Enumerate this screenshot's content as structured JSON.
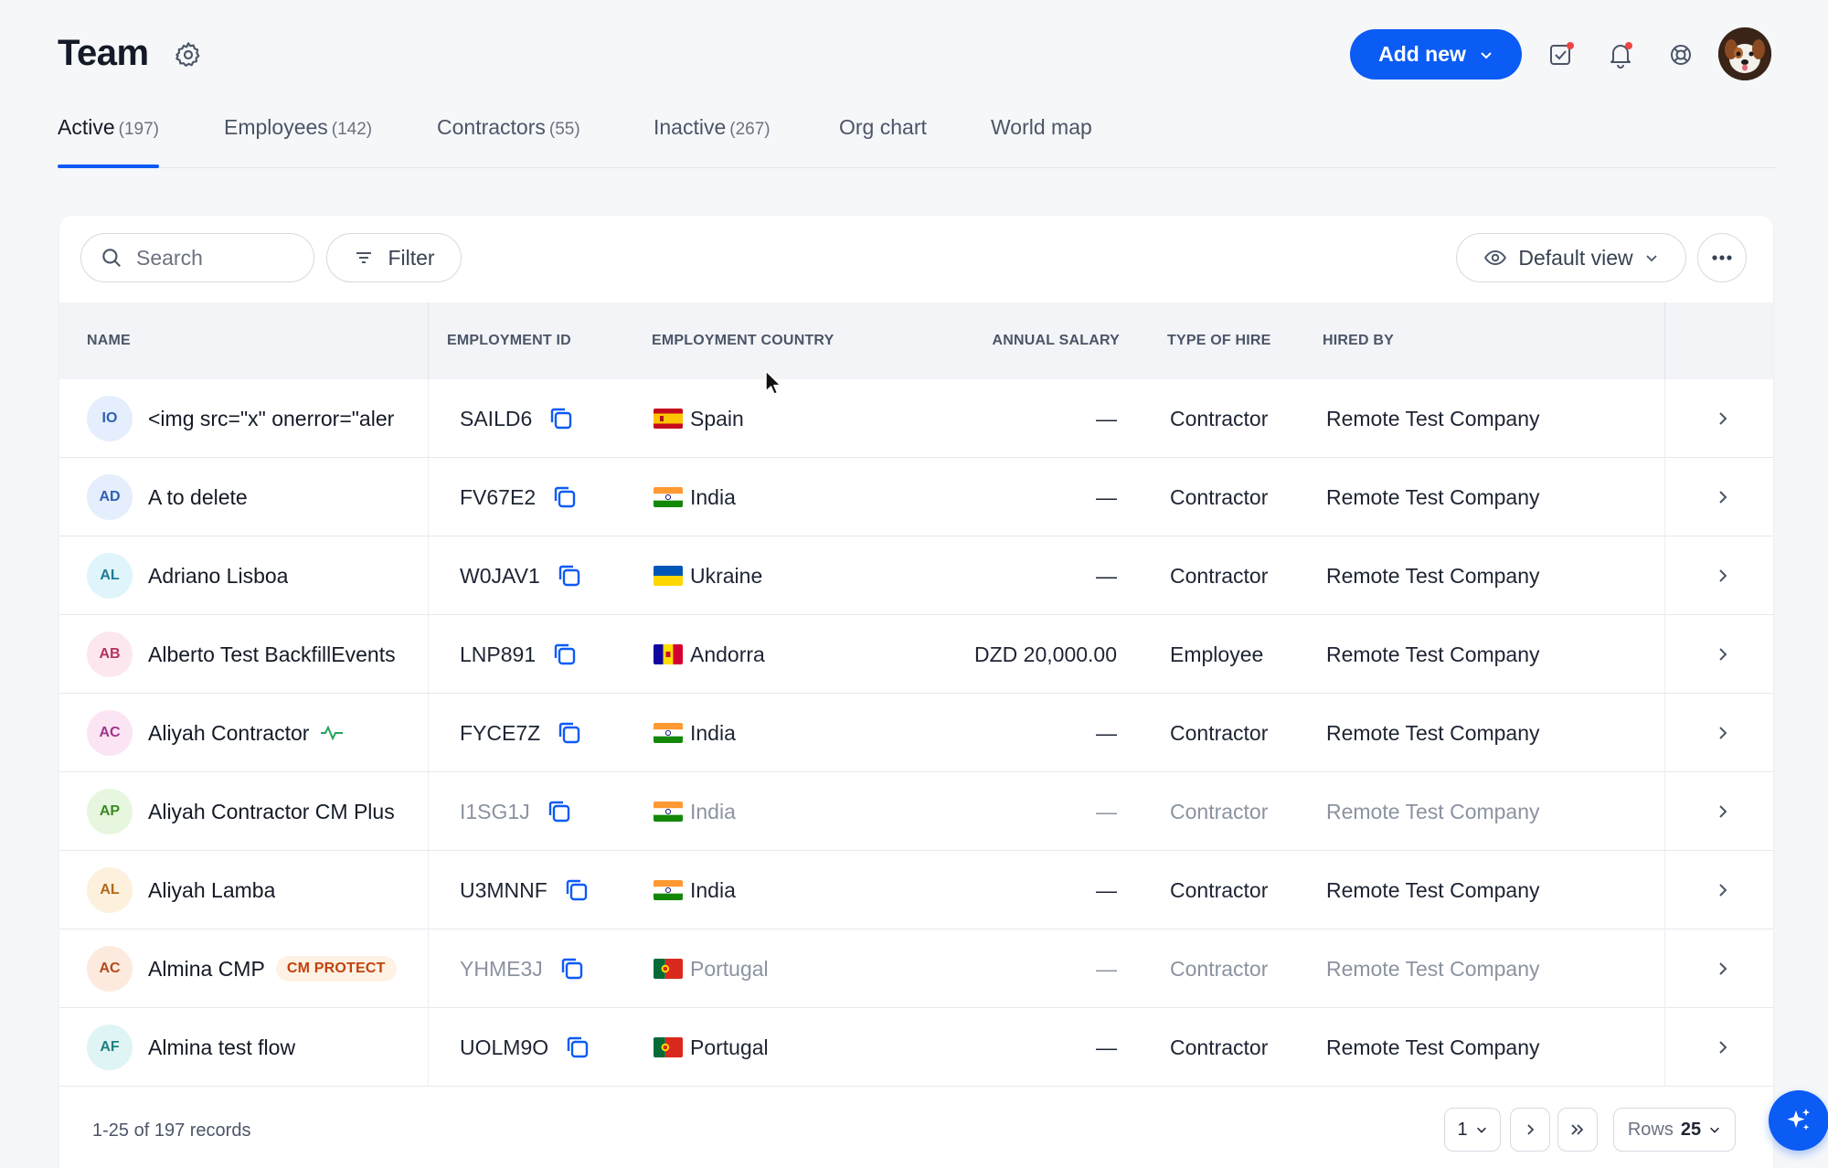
{
  "header": {
    "title": "Team",
    "add_new_label": "Add new"
  },
  "tabs": [
    {
      "label": "Active",
      "count": "(197)",
      "active": true
    },
    {
      "label": "Employees",
      "count": "(142)"
    },
    {
      "label": "Contractors",
      "count": "(55)"
    },
    {
      "label": "Inactive",
      "count": "(267)"
    },
    {
      "label": "Org chart",
      "count": ""
    },
    {
      "label": "World map",
      "count": ""
    }
  ],
  "toolbar": {
    "search_placeholder": "Search",
    "filter_label": "Filter",
    "view_label": "Default view"
  },
  "table": {
    "columns": {
      "name": "NAME",
      "employment_id": "EMPLOYMENT ID",
      "employment_country": "EMPLOYMENT COUNTRY",
      "annual_salary": "ANNUAL SALARY",
      "type_of_hire": "TYPE OF HIRE",
      "hired_by": "HIRED BY"
    },
    "rows": [
      {
        "initials": "IO",
        "name": "<img src=\"x\" onerror=\"aler",
        "id": "SAILD6",
        "country": "Spain",
        "salary": "—",
        "type": "Contractor",
        "hired_by": "Remote Test Company",
        "dim": false
      },
      {
        "initials": "AD",
        "name": "A to delete",
        "id": "FV67E2",
        "country": "India",
        "salary": "—",
        "type": "Contractor",
        "hired_by": "Remote Test Company",
        "dim": false
      },
      {
        "initials": "AL",
        "name": "Adriano Lisboa",
        "id": "W0JAV1",
        "country": "Ukraine",
        "salary": "—",
        "type": "Contractor",
        "hired_by": "Remote Test Company",
        "dim": false
      },
      {
        "initials": "AB",
        "name": "Alberto Test BackfillEvents",
        "id": "LNP891",
        "country": "Andorra",
        "salary": "DZD 20,000.00",
        "type": "Employee",
        "hired_by": "Remote Test Company",
        "dim": false
      },
      {
        "initials": "AC",
        "name": "Aliyah Contractor",
        "id": "FYCE7Z",
        "country": "India",
        "salary": "—",
        "type": "Contractor",
        "hired_by": "Remote Test Company",
        "dim": false,
        "activity_icon": true
      },
      {
        "initials": "AP",
        "name": "Aliyah Contractor CM Plus",
        "id": "I1SG1J",
        "country": "India",
        "salary": "—",
        "type": "Contractor",
        "hired_by": "Remote Test Company",
        "dim": true
      },
      {
        "initials": "AL",
        "name": "Aliyah Lamba",
        "id": "U3MNNF",
        "country": "India",
        "salary": "—",
        "type": "Contractor",
        "hired_by": "Remote Test Company",
        "dim": false
      },
      {
        "initials": "AC",
        "name": "Almina CMP",
        "badge": "CM PROTECT",
        "id": "YHME3J",
        "country": "Portugal",
        "salary": "—",
        "type": "Contractor",
        "hired_by": "Remote Test Company",
        "dim": true
      },
      {
        "initials": "AF",
        "name": "Almina test flow",
        "id": "UOLM9O",
        "country": "Portugal",
        "salary": "—",
        "type": "Contractor",
        "hired_by": "Remote Test Company",
        "dim": false
      }
    ]
  },
  "pagination": {
    "records_label": "1-25 of 197 records",
    "page": "1",
    "rows_label": "Rows",
    "rows_value": "25"
  },
  "colors": {
    "accent": "#0b5bf5",
    "notification_dot": "#ef4444",
    "badge_text": "#c2410c"
  },
  "avatar_palette": {
    "IO": {
      "bg": "#e4eefc",
      "fg": "#2f5fb3"
    },
    "AD": {
      "bg": "#e4eefc",
      "fg": "#2f5fb3"
    },
    "AL0": {
      "bg": "#dff4fb",
      "fg": "#1f7a96"
    },
    "AB": {
      "bg": "#fce7ef",
      "fg": "#b3345f"
    },
    "AC0": {
      "bg": "#fbe4f4",
      "fg": "#a0338a"
    },
    "AP": {
      "bg": "#e6f6df",
      "fg": "#3d8a24"
    },
    "AL1": {
      "bg": "#fdf0dc",
      "fg": "#b0681a"
    },
    "AC1": {
      "bg": "#fdeadf",
      "fg": "#b24a1c"
    },
    "AF": {
      "bg": "#dff4f4",
      "fg": "#1f8080"
    }
  }
}
